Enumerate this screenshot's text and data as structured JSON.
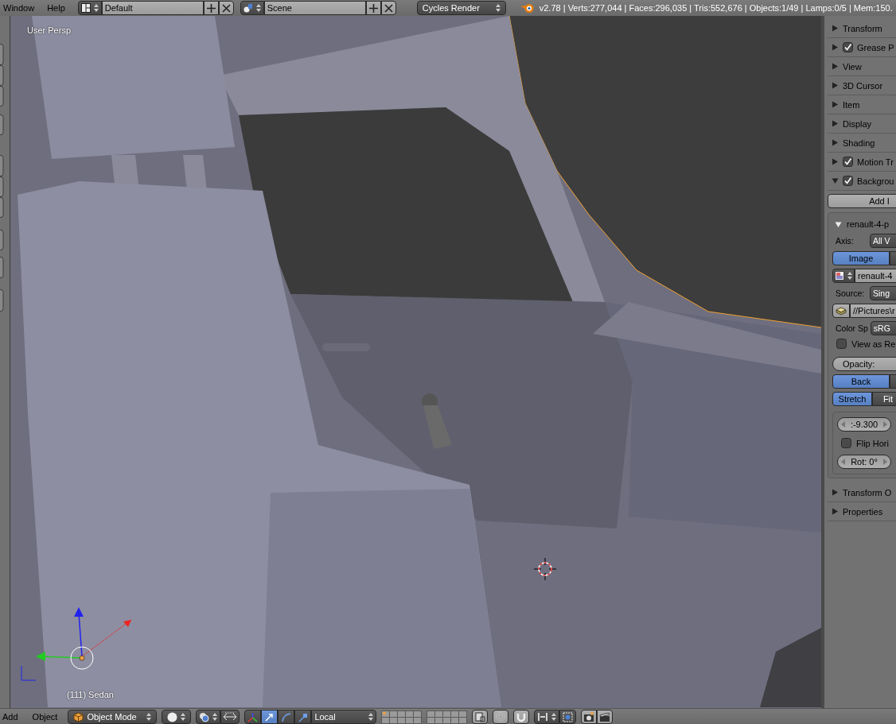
{
  "top_bar": {
    "menus": [
      "Window",
      "Help"
    ],
    "screen_layout": "Default",
    "scene": "Scene",
    "render_engine": "Cycles Render",
    "stats": "v2.78 | Verts:277,044 | Faces:296,035 | Tris:552,676 | Objects:1/49 | Lamps:0/5 | Mem:150."
  },
  "viewport": {
    "view_label": "User Persp",
    "object_label": "(111) Sedan"
  },
  "panels": [
    {
      "kind": "plain",
      "label": "Transform",
      "expanded": false
    },
    {
      "kind": "toggle",
      "label": "Grease P",
      "expanded": false,
      "checked": true
    },
    {
      "kind": "plain",
      "label": "View",
      "expanded": false
    },
    {
      "kind": "plain",
      "label": "3D Cursor",
      "expanded": false
    },
    {
      "kind": "plain",
      "label": "Item",
      "expanded": false
    },
    {
      "kind": "plain",
      "label": "Display",
      "expanded": false
    },
    {
      "kind": "plain",
      "label": "Shading",
      "expanded": false
    },
    {
      "kind": "toggle",
      "label": "Motion Tr",
      "expanded": false,
      "checked": true
    },
    {
      "kind": "toggle",
      "label": "Backgrou",
      "expanded": true,
      "checked": true,
      "content": {
        "add_button": "Add I",
        "image": {
          "name": "renault-4-p",
          "expanded": true,
          "axis_label": "Axis:",
          "axis_value": "All V",
          "source_tabs": [
            {
              "label": "Image",
              "selected": true
            },
            {
              "selected": false
            }
          ],
          "image_name": "renault-4",
          "source_label": "Source:",
          "source_value": "Sing",
          "filepath": "//Pictures\\r",
          "color_space_label": "Color Sp",
          "color_space_value": "sRG",
          "view_as_render": {
            "label": "View as Re",
            "checked": false
          },
          "opacity_label": "Opacity:",
          "depth_tabs": [
            {
              "label": "Back",
              "selected": true
            },
            {
              "selected": false
            }
          ],
          "frame_tabs": [
            {
              "label": "Stretch",
              "selected": true
            },
            {
              "label": "Fit",
              "selected": false
            }
          ],
          "offset_value": ":-9.300",
          "flip": {
            "label": "Flip Hori",
            "checked": false
          },
          "rotation": "Rot: 0°"
        }
      }
    },
    {
      "kind": "plain",
      "label": "Transform O",
      "expanded": false
    },
    {
      "kind": "plain",
      "label": "Properties",
      "expanded": false
    }
  ],
  "bottom_bar": {
    "menus": [
      "Add",
      "Object"
    ],
    "mode": "Object Mode",
    "manipulators": [
      {
        "kind": "translate",
        "selected": true
      },
      {
        "kind": "rotate",
        "selected": false
      },
      {
        "kind": "scale",
        "selected": false
      }
    ],
    "orientation": "Local"
  }
}
